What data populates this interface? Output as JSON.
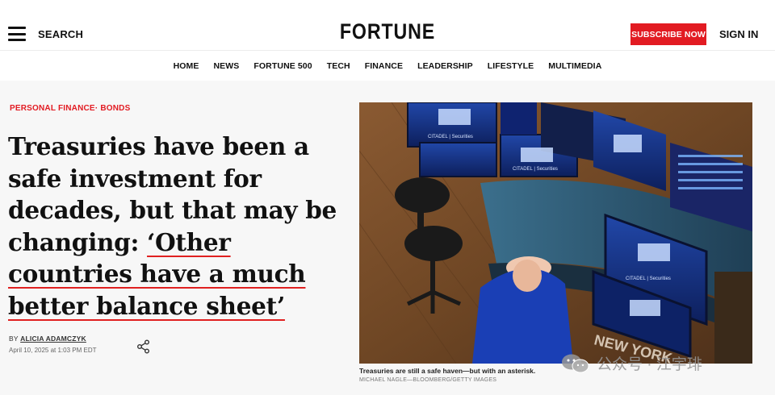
{
  "header": {
    "search_label": "SEARCH",
    "logo": "FORTUNE",
    "subscribe_label": "SUBSCRIBE NOW",
    "signin_label": "SIGN IN"
  },
  "nav": {
    "items": [
      "HOME",
      "NEWS",
      "FORTUNE 500",
      "TECH",
      "FINANCE",
      "LEADERSHIP",
      "LIFESTYLE",
      "MULTIMEDIA"
    ]
  },
  "article": {
    "category_primary": "PERSONAL FINANCE",
    "category_separator": "·",
    "category_secondary": "BONDS",
    "headline_plain": "Treasuries have been a safe investment for decades, but that may be changing: ",
    "headline_quote": "‘Other countries have a much better balance sheet’",
    "byline_prefix": "BY",
    "author": "ALICIA ADAMCZYK",
    "date": "April 10, 2025 at 1:03 PM EDT",
    "image_caption": "Treasuries are still a safe haven—but with an asterisk.",
    "image_credit": "MICHAEL NAGLE—BLOOMBERG/GETTY IMAGES",
    "image_screen_texts": [
      "CITADEL | Securities",
      "NEW YORK"
    ]
  },
  "watermark": {
    "text": "公众号 · 江宇琲"
  },
  "colors": {
    "brand_red": "#e21b22",
    "underline_red": "#e02020",
    "page_bg": "#f7f7f7"
  }
}
